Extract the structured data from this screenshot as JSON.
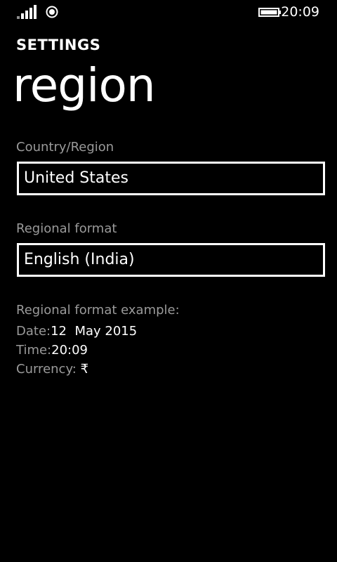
{
  "status_bar": {
    "signal_icon": "signal-strength-icon",
    "location_icon": "location-icon",
    "battery_icon": "battery-icon",
    "time": "20:09"
  },
  "header": {
    "app_title": "SETTINGS",
    "page_title": "region"
  },
  "country": {
    "label": "Country/Region",
    "value": "United States"
  },
  "regional_format": {
    "label": "Regional format",
    "value": "English (India)"
  },
  "example": {
    "heading": "Regional format example:",
    "date_label": "Date:",
    "date_value": "12  May 2015",
    "time_label": "Time:",
    "time_value": "20:09",
    "currency_label": "Currency: ",
    "currency_value": "₹"
  }
}
